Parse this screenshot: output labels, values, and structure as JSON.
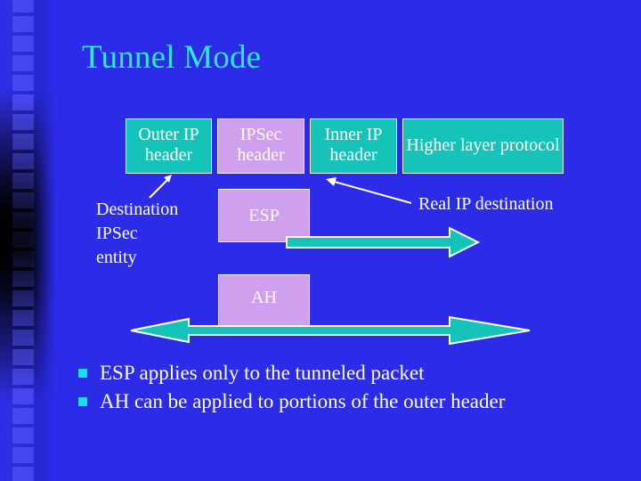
{
  "slide": {
    "title": "Tunnel Mode",
    "background_color": "#2b2be8",
    "title_color": "#2ee6e0"
  },
  "packet_header": {
    "boxes": [
      {
        "label": "Outer IP\nheader",
        "color": "#16c3b8",
        "kind": "teal"
      },
      {
        "label": "IPSec\nheader",
        "color": "#cfa0ee",
        "kind": "violet"
      },
      {
        "label": "Inner IP\nheader",
        "color": "#16c3b8",
        "kind": "teal"
      },
      {
        "label": "Higher\nlayer protocol",
        "color": "#16c3b8",
        "kind": "teal"
      }
    ]
  },
  "protocol_blocks": [
    {
      "label": "ESP",
      "color": "#cfa0ee"
    },
    {
      "label": "AH",
      "color": "#cfa0ee"
    }
  ],
  "callouts": {
    "destination": "Destination\nIPSec\nentity",
    "real_destination": "Real IP destination"
  },
  "coverage_arrows": {
    "esp_arrow_color": "#16c3b8",
    "ah_arrow_color": "#16c3b8",
    "outline_color": "#ffffff"
  },
  "bullets": [
    {
      "marker_color": "#19e0e0",
      "text": "ESP applies only to the tunneled packet"
    },
    {
      "marker_color": "#19e0e0",
      "text": "AH can be applied to portions of the outer header"
    }
  ]
}
